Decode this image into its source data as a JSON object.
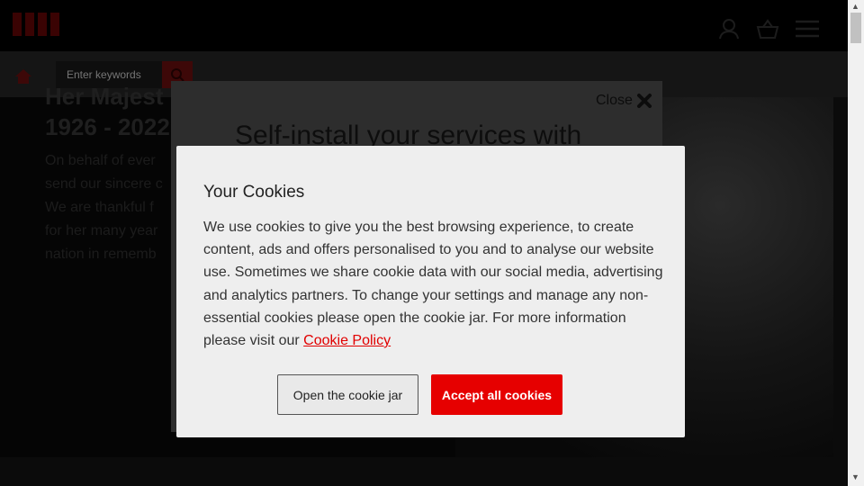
{
  "header": {
    "account_icon": "user-icon",
    "basket_icon": "basket-icon",
    "menu_icon": "hamburger-menu-icon"
  },
  "subnav": {
    "home_icon": "home-icon",
    "search_placeholder": "Enter keywords",
    "search_icon": "search-icon"
  },
  "hero": {
    "title": "Her Majest\n1926 - 2022",
    "text": "On behalf of ever\nsend our sincere c\nWe are thankful f\nfor her many year\nnation in rememb"
  },
  "promo_modal": {
    "close_label": "Close",
    "title": "Self-install your services with"
  },
  "cookie_dialog": {
    "title": "Your Cookies",
    "body": "We use cookies to give you the best browsing experience, to create content, ads and offers personalised to you and to analyse our website use. Sometimes we share cookie data with our social media, advertising and analytics partners. To change your settings and manage any non-essential cookies please open the cookie jar. For more information please visit our ",
    "link_label": "Cookie Policy",
    "open_jar_label": "Open the cookie jar",
    "accept_label": "Accept all cookies"
  },
  "colors": {
    "accent_red": "#e60000",
    "dialog_bg": "#eeeeee"
  }
}
